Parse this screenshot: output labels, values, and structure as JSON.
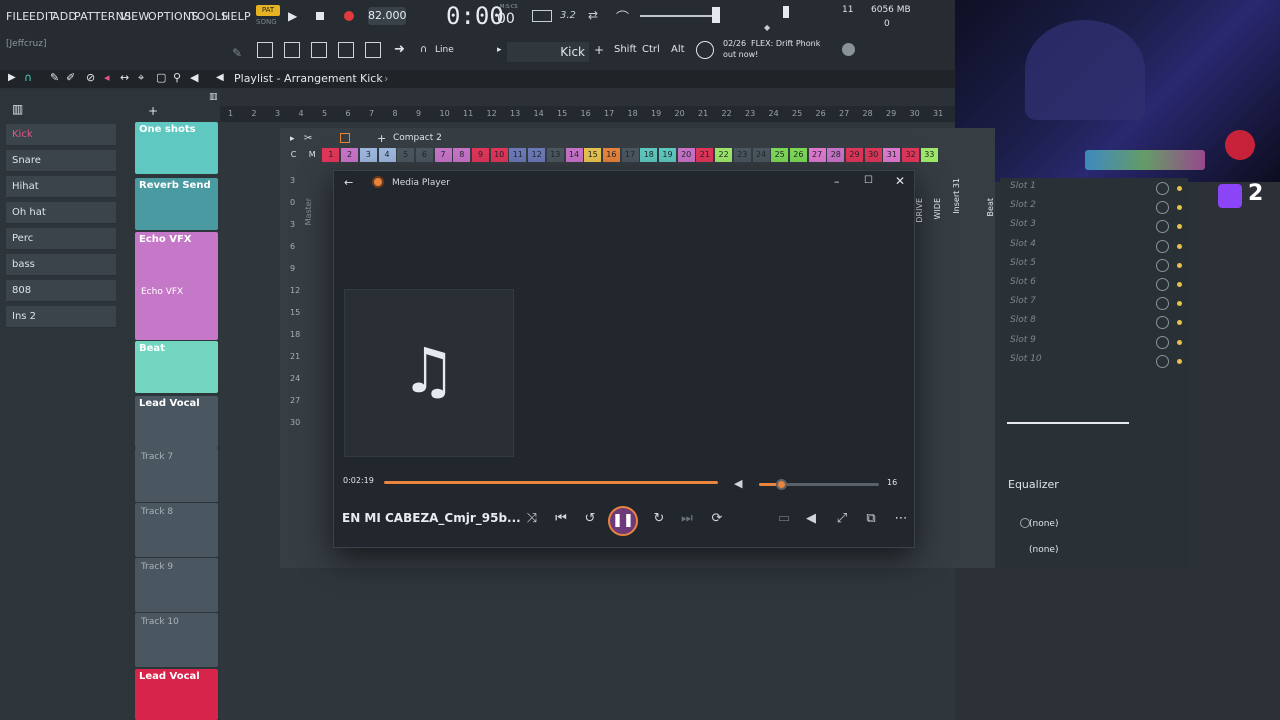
{
  "menubar": {
    "items": [
      "FILE",
      "EDIT",
      "ADD",
      "PATTERNS",
      "VIEW",
      "OPTIONS",
      "TOOLS",
      "HELP"
    ],
    "pat_label": "PAT",
    "song_label": "SONG",
    "tempo": "82.000",
    "time": "0:00",
    "time_small": "00",
    "time_unit": "M:S:CS",
    "snap_label": "3.2",
    "cpu_num": "11",
    "memory": "6056 MB",
    "poly": "0"
  },
  "user": "[Jeffcruz]",
  "toolbar": {
    "line_label": "Line",
    "pattern_name": "Kick",
    "shift": "Shift",
    "ctrl": "Ctrl",
    "alt": "Alt",
    "hint_counter": "02/26",
    "hint_text": "FLEX: Drift Phonk",
    "hint_text2": "out now!"
  },
  "playlist": {
    "title": "Playlist - Arrangement",
    "pattern": "Kick"
  },
  "channels": [
    "Kick",
    "Snare",
    "Hihat",
    "Oh hat",
    "Perc",
    "bass",
    "808",
    "Ins 2"
  ],
  "tracks": [
    {
      "name": "One shots"
    },
    {
      "name": "Reverb Send"
    },
    {
      "name": "Echo VFX",
      "sub": "Echo VFX"
    },
    {
      "name": "Beat"
    },
    {
      "name": "Lead Vocal"
    },
    {
      "name": "Track 7"
    },
    {
      "name": "Track 8"
    },
    {
      "name": "Track 9"
    },
    {
      "name": "Track 10"
    },
    {
      "name": "Lead Vocal"
    }
  ],
  "ruler": [
    "1",
    "2",
    "3",
    "4",
    "5",
    "6",
    "7",
    "8",
    "9",
    "10",
    "11",
    "12",
    "13",
    "14",
    "15",
    "16",
    "17",
    "18",
    "19",
    "20",
    "21",
    "22",
    "23",
    "24",
    "25",
    "26",
    "27",
    "28",
    "29",
    "30",
    "31"
  ],
  "mixer": {
    "view_name": "Compact 2",
    "channel_numbers": [
      "C",
      "M",
      "1",
      "2",
      "3",
      "4",
      "5",
      "6",
      "7",
      "8",
      "9",
      "10",
      "11",
      "12",
      "13",
      "14",
      "15",
      "16",
      "17",
      "18",
      "19",
      "20",
      "21",
      "22",
      "23",
      "24",
      "25",
      "26",
      "27",
      "28",
      "29",
      "30",
      "31",
      "32",
      "33"
    ],
    "db_scale": [
      "3",
      "0",
      "3",
      "6",
      "9",
      "12",
      "15",
      "18",
      "21",
      "24",
      "27",
      "30"
    ],
    "master_label": "Master",
    "insert_labels": [
      "DRIVE",
      "WIDE",
      "Insert 31",
      "Beat"
    ]
  },
  "slots": [
    "Slot 1",
    "Slot 2",
    "Slot 3",
    "Slot 4",
    "Slot 5",
    "Slot 6",
    "Slot 7",
    "Slot 8",
    "Slot 9",
    "Slot 10"
  ],
  "effects": {
    "equalizer": "Equalizer",
    "out1": "(none)",
    "out2": "(none)"
  },
  "stream_overlay": {
    "badge": "2"
  },
  "media_player": {
    "title": "Media Player",
    "elapsed": "0:02:19",
    "volume": "16",
    "volume_level": 0.18,
    "song_title": "EN MI CABEZA_Cmjr_95b..."
  },
  "colors": {
    "accent": "#e8843c",
    "kick_clip": "#5fc9c1",
    "echo_clip": "#c678c8",
    "beat_clip": "#73d6c0",
    "vocal_red": "#d6244a"
  }
}
